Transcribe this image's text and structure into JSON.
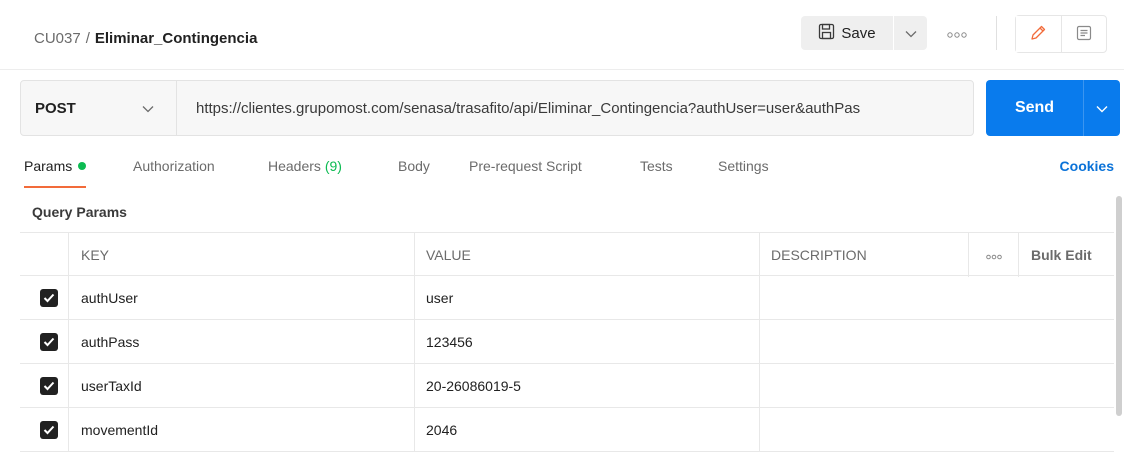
{
  "header": {
    "collection": "CU037",
    "separator": "/",
    "request_name": "Eliminar_Contingencia",
    "save_label": "Save"
  },
  "request": {
    "method": "POST",
    "url": "https://clientes.grupomost.com/senasa/trasafito/api/Eliminar_Contingencia?authUser=user&authPas",
    "send_label": "Send"
  },
  "tabs": {
    "params": "Params",
    "authorization": "Authorization",
    "headers": "Headers",
    "headers_count": "(9)",
    "body": "Body",
    "prerequest": "Pre-request Script",
    "tests": "Tests",
    "settings": "Settings",
    "cookies": "Cookies"
  },
  "params": {
    "section_title": "Query Params",
    "columns": {
      "key": "KEY",
      "value": "VALUE",
      "description": "DESCRIPTION",
      "bulk_edit": "Bulk Edit"
    },
    "rows": [
      {
        "checked": true,
        "key": "authUser",
        "value": "user",
        "description": ""
      },
      {
        "checked": true,
        "key": "authPass",
        "value": "123456",
        "description": ""
      },
      {
        "checked": true,
        "key": "userTaxId",
        "value": "20-26086019-5",
        "description": ""
      },
      {
        "checked": true,
        "key": "movementId",
        "value": "2046",
        "description": ""
      }
    ]
  },
  "colors": {
    "send": "#097bed",
    "active_tab": "#f26b3a",
    "status_dot": "#0cbb52",
    "link": "#0a72d8"
  },
  "icons": [
    "save-icon",
    "chevron-down-icon",
    "more-horizontal-icon",
    "pencil-icon",
    "documentation-icon",
    "checkbox-checked-icon"
  ]
}
